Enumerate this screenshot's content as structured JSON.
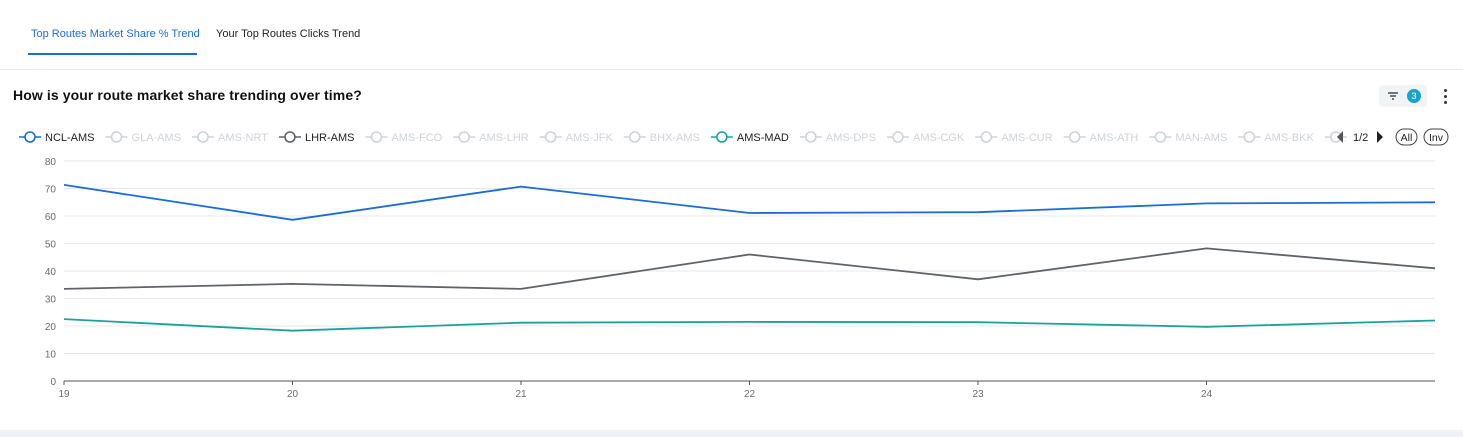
{
  "tabs": [
    {
      "label": "Top Routes Market Share % Trend",
      "active": true
    },
    {
      "label": "Your Top Routes Clicks Trend",
      "active": false
    }
  ],
  "heading": "How is your route market share trending over time?",
  "filter": {
    "icon": "filter-icon",
    "count": "3"
  },
  "menu_icon": "kebab-menu-icon",
  "legend": {
    "page": "1/2",
    "all_label": "All",
    "inv_label": "Inv",
    "inactive_color": "#cfd3d8",
    "items": [
      {
        "name": "NCL-AMS",
        "active": true,
        "color": "#1a6dd6"
      },
      {
        "name": "GLA-AMS",
        "active": false
      },
      {
        "name": "AMS-NRT",
        "active": false
      },
      {
        "name": "LHR-AMS",
        "active": true,
        "color": "#5f6368"
      },
      {
        "name": "AMS-FCO",
        "active": false
      },
      {
        "name": "AMS-LHR",
        "active": false
      },
      {
        "name": "AMS-JFK",
        "active": false
      },
      {
        "name": "BHX-AMS",
        "active": false
      },
      {
        "name": "AMS-MAD",
        "active": true,
        "color": "#1aa39b"
      },
      {
        "name": "AMS-DPS",
        "active": false
      },
      {
        "name": "AMS-CGK",
        "active": false
      },
      {
        "name": "AMS-CUR",
        "active": false
      },
      {
        "name": "AMS-ATH",
        "active": false
      },
      {
        "name": "MAN-AMS",
        "active": false
      },
      {
        "name": "AMS-BKK",
        "active": false
      },
      {
        "name": "",
        "active": false
      }
    ]
  },
  "chart_data": {
    "type": "line",
    "x": [
      "19",
      "20",
      "21",
      "22",
      "23",
      "24",
      "25"
    ],
    "x_tick_labels": [
      "19",
      "20",
      "21",
      "22",
      "23",
      "24"
    ],
    "y_ticks": [
      "0",
      "10",
      "20",
      "30",
      "40",
      "50",
      "60",
      "70",
      "80"
    ],
    "ylim": [
      0,
      80
    ],
    "grid": true,
    "legend_placement": "top",
    "series": [
      {
        "name": "NCL-AMS",
        "color": "#1a6dd6",
        "values": [
          71.3,
          58.6,
          70.7,
          61.1,
          61.4,
          64.6,
          65.0
        ]
      },
      {
        "name": "LHR-AMS",
        "color": "#5f6368",
        "values": [
          33.5,
          35.3,
          33.5,
          46.0,
          37.0,
          48.2,
          41.0
        ]
      },
      {
        "name": "AMS-MAD",
        "color": "#1aa39b",
        "values": [
          22.5,
          18.3,
          21.2,
          21.5,
          21.4,
          19.7,
          22.0
        ]
      }
    ]
  }
}
